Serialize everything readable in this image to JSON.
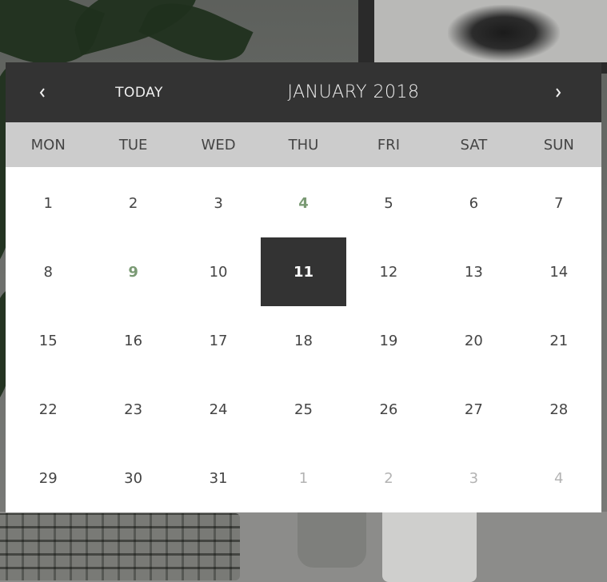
{
  "header": {
    "prev_icon": "chevron-left-icon",
    "next_icon": "chevron-right-icon",
    "today_label": "TODAY",
    "month_title": "JANUARY 2018"
  },
  "weekdays": [
    "MON",
    "TUE",
    "WED",
    "THU",
    "FRI",
    "SAT",
    "SUN"
  ],
  "days": [
    {
      "label": "1",
      "state": "normal"
    },
    {
      "label": "2",
      "state": "normal"
    },
    {
      "label": "3",
      "state": "normal"
    },
    {
      "label": "4",
      "state": "marked"
    },
    {
      "label": "5",
      "state": "normal"
    },
    {
      "label": "6",
      "state": "normal"
    },
    {
      "label": "7",
      "state": "normal"
    },
    {
      "label": "8",
      "state": "normal"
    },
    {
      "label": "9",
      "state": "marked"
    },
    {
      "label": "10",
      "state": "normal"
    },
    {
      "label": "11",
      "state": "selected"
    },
    {
      "label": "12",
      "state": "normal"
    },
    {
      "label": "13",
      "state": "normal"
    },
    {
      "label": "14",
      "state": "normal"
    },
    {
      "label": "15",
      "state": "normal"
    },
    {
      "label": "16",
      "state": "normal"
    },
    {
      "label": "17",
      "state": "normal"
    },
    {
      "label": "18",
      "state": "normal"
    },
    {
      "label": "19",
      "state": "normal"
    },
    {
      "label": "20",
      "state": "normal"
    },
    {
      "label": "21",
      "state": "normal"
    },
    {
      "label": "22",
      "state": "normal"
    },
    {
      "label": "23",
      "state": "normal"
    },
    {
      "label": "24",
      "state": "normal"
    },
    {
      "label": "25",
      "state": "normal"
    },
    {
      "label": "26",
      "state": "normal"
    },
    {
      "label": "27",
      "state": "normal"
    },
    {
      "label": "28",
      "state": "normal"
    },
    {
      "label": "29",
      "state": "normal"
    },
    {
      "label": "30",
      "state": "normal"
    },
    {
      "label": "31",
      "state": "normal"
    },
    {
      "label": "1",
      "state": "other"
    },
    {
      "label": "2",
      "state": "other"
    },
    {
      "label": "3",
      "state": "other"
    },
    {
      "label": "4",
      "state": "other"
    }
  ],
  "colors": {
    "header_bg": "#333333",
    "weekday_bg": "#cccccc",
    "marked": "#7a9a74",
    "selected_bg": "#333333",
    "other_month": "#b3b3b3"
  }
}
